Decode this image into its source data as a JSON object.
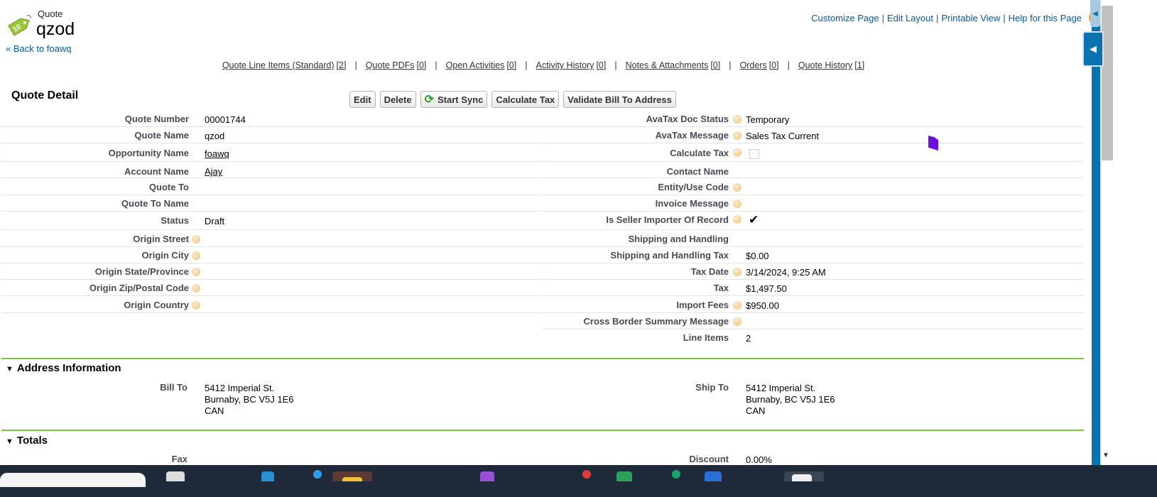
{
  "header": {
    "object_type": "Quote",
    "record_name": "qzod",
    "back_link": "« Back to foawq",
    "quote_icon": "price-tag-icon",
    "top_links": [
      "Customize Page",
      "Edit Layout",
      "Printable View",
      "Help for this Page"
    ],
    "help_icon": "?"
  },
  "related_lists": [
    {
      "label": "Quote Line Items (Standard)",
      "count": "[2]"
    },
    {
      "label": "Quote PDFs",
      "count": "[0]"
    },
    {
      "label": "Open Activities",
      "count": "[0]"
    },
    {
      "label": "Activity History",
      "count": "[0]"
    },
    {
      "label": "Notes & Attachments",
      "count": "[0]"
    },
    {
      "label": "Orders",
      "count": "[0]"
    },
    {
      "label": "Quote History",
      "count": "[1]"
    }
  ],
  "detail": {
    "title": "Quote Detail",
    "buttons": {
      "edit": "Edit",
      "delete": "Delete",
      "start_sync": "Start Sync",
      "calculate_tax": "Calculate Tax",
      "validate": "Validate Bill To Address"
    },
    "left_fields": {
      "quote_number": {
        "label": "Quote Number",
        "value": "00001744"
      },
      "quote_name": {
        "label": "Quote Name",
        "value": "qzod"
      },
      "opportunity_name": {
        "label": "Opportunity Name",
        "value": "foawq"
      },
      "account_name": {
        "label": "Account Name",
        "value": "Ajay"
      },
      "quote_to": {
        "label": "Quote To",
        "value": ""
      },
      "quote_to_name": {
        "label": "Quote To Name",
        "value": ""
      },
      "status": {
        "label": "Status",
        "value": "Draft"
      },
      "origin_street": {
        "label": "Origin Street",
        "value": ""
      },
      "origin_city": {
        "label": "Origin City",
        "value": ""
      },
      "origin_state": {
        "label": "Origin State/Province",
        "value": ""
      },
      "origin_zip": {
        "label": "Origin Zip/Postal Code",
        "value": ""
      },
      "origin_country": {
        "label": "Origin Country",
        "value": ""
      }
    },
    "right_fields": {
      "avatax_doc_status": {
        "label": "AvaTax Doc Status",
        "value": "Temporary"
      },
      "avatax_message": {
        "label": "AvaTax Message",
        "value": "Sales Tax Current"
      },
      "calculate_tax": {
        "label": "Calculate Tax",
        "checked": false
      },
      "contact_name": {
        "label": "Contact Name",
        "value": ""
      },
      "entity_use_code": {
        "label": "Entity/Use Code",
        "value": ""
      },
      "invoice_message": {
        "label": "Invoice Message",
        "value": ""
      },
      "seller_importer": {
        "label": "Is Seller Importer Of Record",
        "checked": true,
        "check_glyph": "✔"
      },
      "shipping_handling": {
        "label": "Shipping and Handling",
        "value": ""
      },
      "shipping_handling_tax": {
        "label": "Shipping and Handling Tax",
        "value": "$0.00"
      },
      "tax_date": {
        "label": "Tax Date",
        "value": "3/14/2024, 9:25 AM"
      },
      "tax": {
        "label": "Tax",
        "value": "$1,497.50"
      },
      "import_fees": {
        "label": "Import Fees",
        "value": "$950.00"
      },
      "cross_border": {
        "label": "Cross Border Summary Message",
        "value": ""
      },
      "line_items": {
        "label": "Line Items",
        "value": "2"
      }
    }
  },
  "address_section": {
    "title": "Address Information",
    "bill_to": {
      "label": "Bill To",
      "line1": "5412 Imperial St.",
      "line2": "Burnaby, BC V5J 1E6",
      "line3": "CAN"
    },
    "ship_to": {
      "label": "Ship To",
      "line1": "5412 Imperial St.",
      "line2": "Burnaby, BC V5J 1E6",
      "line3": "CAN"
    }
  },
  "totals_section": {
    "title": "Totals",
    "fax": {
      "label": "Fax",
      "value": ""
    },
    "discount": {
      "label": "Discount",
      "value": "0.00%"
    }
  },
  "colors": {
    "link": "#015ba7",
    "section_line": "#7dc443",
    "label": "#4a4a56",
    "sidebar_blue": "#0b72b0"
  }
}
